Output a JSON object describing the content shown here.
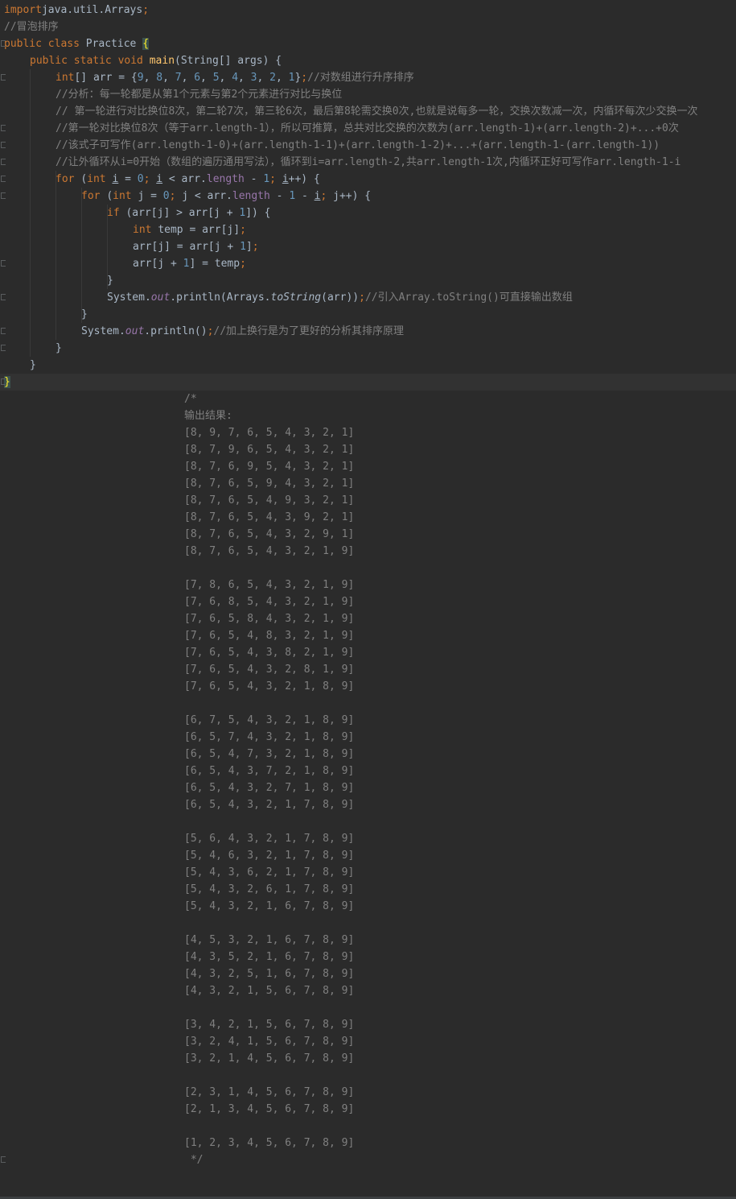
{
  "code_lines": [
    {
      "segs": [
        [
          "kw",
          "import"
        ],
        [
          "",
          "java.util.Arrays"
        ],
        [
          "kw",
          ";"
        ]
      ]
    },
    {
      "segs": [
        [
          "cm",
          "//冒泡排序"
        ]
      ]
    },
    {
      "segs": [
        [
          "kw",
          "public class "
        ],
        [
          "",
          "Practice "
        ],
        [
          "brace-hl",
          "{"
        ]
      ]
    },
    {
      "segs": [
        [
          "kw",
          "public static void "
        ],
        [
          "mth",
          "main"
        ],
        [
          "",
          "(String[] args) {"
        ]
      ]
    },
    {
      "segs": [
        [
          "kw",
          "int"
        ],
        [
          "",
          "[] arr = {"
        ],
        [
          "num",
          "9"
        ],
        [
          "",
          ", "
        ],
        [
          "num",
          "8"
        ],
        [
          "",
          ", "
        ],
        [
          "num",
          "7"
        ],
        [
          "",
          ", "
        ],
        [
          "num",
          "6"
        ],
        [
          "",
          ", "
        ],
        [
          "num",
          "5"
        ],
        [
          "",
          ", "
        ],
        [
          "num",
          "4"
        ],
        [
          "",
          ", "
        ],
        [
          "num",
          "3"
        ],
        [
          "",
          ", "
        ],
        [
          "num",
          "2"
        ],
        [
          "",
          ", "
        ],
        [
          "num",
          "1"
        ],
        [
          "",
          "}"
        ],
        [
          "kw",
          ";"
        ],
        [
          "cm",
          "//对数组进行升序排序"
        ]
      ]
    },
    {
      "segs": [
        [
          "cm",
          "//分析：每一轮都是从第1个元素与第2个元素进行对比与换位"
        ]
      ]
    },
    {
      "segs": [
        [
          "cm",
          "// 第一轮进行对比换位8次，第二轮7次，第三轮6次，最后第8轮需交换0次,也就是说每多一轮，交换次数减一次，内循环每次少交换一次"
        ]
      ]
    },
    {
      "segs": [
        [
          "cm",
          "//第一轮对比换位8次（等于arr.length-1），所以可推算，总共对比交换的次数为(arr.length-1)+(arr.length-2)+...+0次"
        ]
      ]
    },
    {
      "segs": [
        [
          "cm",
          "//该式子可写作(arr.length-1-0)+(arr.length-1-1)+(arr.length-1-2)+...+(arr.length-1-(arr.length-1))"
        ]
      ]
    },
    {
      "segs": [
        [
          "cm",
          "//让外循环从i=0开始（数组的遍历通用写法），循环到i=arr.length-2,共arr.length-1次,内循环正好可写作arr.length-1-i"
        ]
      ]
    },
    {
      "segs": [
        [
          "kw",
          "for "
        ],
        [
          "",
          "("
        ],
        [
          "kw",
          "int "
        ],
        [
          "ul",
          "i"
        ],
        [
          "",
          " = "
        ],
        [
          "num",
          "0"
        ],
        [
          "kw",
          "; "
        ],
        [
          "ul",
          "i"
        ],
        [
          "",
          " < arr."
        ],
        [
          "fld",
          "length "
        ],
        [
          "",
          "- "
        ],
        [
          "num",
          "1"
        ],
        [
          "kw",
          "; "
        ],
        [
          "ul",
          "i"
        ],
        [
          "",
          "++) {"
        ]
      ]
    },
    {
      "segs": [
        [
          "kw",
          "for "
        ],
        [
          "",
          "("
        ],
        [
          "kw",
          "int "
        ],
        [
          "",
          "j = "
        ],
        [
          "num",
          "0"
        ],
        [
          "kw",
          "; "
        ],
        [
          "",
          "j < arr."
        ],
        [
          "fld",
          "length "
        ],
        [
          "",
          "- "
        ],
        [
          "num",
          "1 "
        ],
        [
          "",
          "- "
        ],
        [
          "ul",
          "i"
        ],
        [
          "kw",
          "; "
        ],
        [
          "",
          "j++) {"
        ]
      ]
    },
    {
      "segs": [
        [
          "kw",
          "if "
        ],
        [
          "",
          "(arr[j] > arr[j + "
        ],
        [
          "num",
          "1"
        ],
        [
          "",
          "]) {"
        ]
      ]
    },
    {
      "segs": [
        [
          "kw",
          "int "
        ],
        [
          "",
          "temp = arr[j]"
        ],
        [
          "kw",
          ";"
        ]
      ]
    },
    {
      "segs": [
        [
          "",
          "arr[j] = arr[j + "
        ],
        [
          "num",
          "1"
        ],
        [
          "",
          "]"
        ],
        [
          "kw",
          ";"
        ]
      ]
    },
    {
      "segs": [
        [
          "",
          "arr[j + "
        ],
        [
          "num",
          "1"
        ],
        [
          "",
          "] = temp"
        ],
        [
          "kw",
          ";"
        ]
      ]
    },
    {
      "segs": [
        [
          "",
          "}"
        ]
      ]
    },
    {
      "segs": [
        [
          "",
          "System."
        ],
        [
          "fld-i",
          "out"
        ],
        [
          "",
          ".println(Arrays."
        ],
        [
          "sti",
          "toString"
        ],
        [
          "",
          "(arr))"
        ],
        [
          "kw",
          ";"
        ],
        [
          "cm",
          "//引入Array.toString()可直接输出数组"
        ]
      ]
    },
    {
      "segs": [
        [
          "",
          "}"
        ]
      ]
    },
    {
      "segs": [
        [
          "",
          "System."
        ],
        [
          "fld-i",
          "out"
        ],
        [
          "",
          ".println()"
        ],
        [
          "kw",
          ";"
        ],
        [
          "cm",
          "//加上换行是为了更好的分析其排序原理"
        ]
      ]
    },
    {
      "segs": [
        [
          "",
          "}"
        ]
      ]
    },
    {
      "segs": [
        [
          "",
          "}"
        ]
      ]
    },
    {
      "segs": [
        [
          "brace-hl",
          "}"
        ]
      ]
    }
  ],
  "comment_block": {
    "open": "/*",
    "title": "输出结果:",
    "rows": [
      "[8, 9, 7, 6, 5, 4, 3, 2, 1]",
      "[8, 7, 9, 6, 5, 4, 3, 2, 1]",
      "[8, 7, 6, 9, 5, 4, 3, 2, 1]",
      "[8, 7, 6, 5, 9, 4, 3, 2, 1]",
      "[8, 7, 6, 5, 4, 9, 3, 2, 1]",
      "[8, 7, 6, 5, 4, 3, 9, 2, 1]",
      "[8, 7, 6, 5, 4, 3, 2, 9, 1]",
      "[8, 7, 6, 5, 4, 3, 2, 1, 9]",
      "",
      "[7, 8, 6, 5, 4, 3, 2, 1, 9]",
      "[7, 6, 8, 5, 4, 3, 2, 1, 9]",
      "[7, 6, 5, 8, 4, 3, 2, 1, 9]",
      "[7, 6, 5, 4, 8, 3, 2, 1, 9]",
      "[7, 6, 5, 4, 3, 8, 2, 1, 9]",
      "[7, 6, 5, 4, 3, 2, 8, 1, 9]",
      "[7, 6, 5, 4, 3, 2, 1, 8, 9]",
      "",
      "[6, 7, 5, 4, 3, 2, 1, 8, 9]",
      "[6, 5, 7, 4, 3, 2, 1, 8, 9]",
      "[6, 5, 4, 7, 3, 2, 1, 8, 9]",
      "[6, 5, 4, 3, 7, 2, 1, 8, 9]",
      "[6, 5, 4, 3, 2, 7, 1, 8, 9]",
      "[6, 5, 4, 3, 2, 1, 7, 8, 9]",
      "",
      "[5, 6, 4, 3, 2, 1, 7, 8, 9]",
      "[5, 4, 6, 3, 2, 1, 7, 8, 9]",
      "[5, 4, 3, 6, 2, 1, 7, 8, 9]",
      "[5, 4, 3, 2, 6, 1, 7, 8, 9]",
      "[5, 4, 3, 2, 1, 6, 7, 8, 9]",
      "",
      "[4, 5, 3, 2, 1, 6, 7, 8, 9]",
      "[4, 3, 5, 2, 1, 6, 7, 8, 9]",
      "[4, 3, 2, 5, 1, 6, 7, 8, 9]",
      "[4, 3, 2, 1, 5, 6, 7, 8, 9]",
      "",
      "[3, 4, 2, 1, 5, 6, 7, 8, 9]",
      "[3, 2, 4, 1, 5, 6, 7, 8, 9]",
      "[3, 2, 1, 4, 5, 6, 7, 8, 9]",
      "",
      "[2, 3, 1, 4, 5, 6, 7, 8, 9]",
      "[2, 1, 3, 4, 5, 6, 7, 8, 9]",
      "",
      "[1, 2, 3, 4, 5, 6, 7, 8, 9]"
    ],
    "close": " */"
  },
  "colors": {
    "background": "#2b2b2b",
    "current_line": "#323232",
    "keyword": "#cc7832",
    "number": "#6897bb",
    "comment": "#808080",
    "field": "#9876aa",
    "method": "#ffc66d",
    "text": "#a9b7c6"
  }
}
